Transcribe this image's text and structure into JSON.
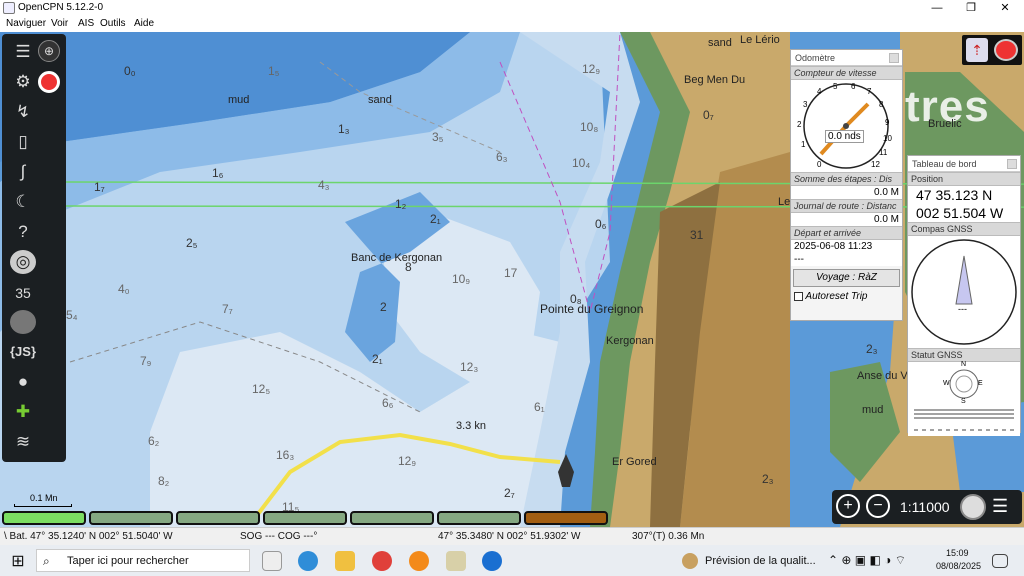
{
  "window": {
    "title": "OpenCPN 5.12.2-0",
    "minimize": "—",
    "maximize": "❐",
    "close": "✕"
  },
  "menu": [
    "Naviguer",
    "Voir",
    "AIS",
    "Outils",
    "Aide"
  ],
  "toolbar": {
    "items": [
      "menu-icon",
      "compass-icon",
      "settings-icon",
      "lifebuoy-icon",
      "route-icon",
      "chart-icon",
      "track-icon",
      "moon-icon",
      "help-icon",
      "layer-icon",
      "display-icon",
      "zoom-rect-icon",
      "js-plugin-icon",
      "globe-icon",
      "puzzle-icon",
      "tide-icon"
    ],
    "js_label": "{JS}",
    "scale_num": "35"
  },
  "chart": {
    "labels": {
      "mud1": "mud",
      "sand1": "sand",
      "sand_top": "sand",
      "le_lerio": "Le Lério",
      "beg_men_du": "Beg Men Du",
      "banc": "Banc de Kergonan",
      "pointe": "Pointe du Greignon",
      "kergonan": "Kergonan",
      "er_gored": "Er Gored",
      "anse": "Anse du V",
      "mud2": "mud",
      "tres": "tres",
      "bruelic": "Bruelic",
      "distance": "3.3 kn",
      "le": "Le"
    },
    "depths": [
      {
        "v": "0₀"
      },
      {
        "v": "1₅"
      },
      {
        "v": "1₃"
      },
      {
        "v": "1₆"
      },
      {
        "v": "1₇"
      },
      {
        "v": "1₂"
      },
      {
        "v": "2₁"
      },
      {
        "v": "2₅"
      },
      {
        "v": "8"
      },
      {
        "v": "2"
      },
      {
        "v": "2₁"
      },
      {
        "v": "4₀"
      },
      {
        "v": "5₄"
      },
      {
        "v": "7₇"
      },
      {
        "v": "7₉"
      },
      {
        "v": "12₅"
      },
      {
        "v": "16₃"
      },
      {
        "v": "6₂"
      },
      {
        "v": "8₂"
      },
      {
        "v": "11₅"
      },
      {
        "v": "6₆"
      },
      {
        "v": "12₃"
      },
      {
        "v": "6₁"
      },
      {
        "v": "10₉"
      },
      {
        "v": "17"
      },
      {
        "v": "3₅"
      },
      {
        "v": "4₃"
      },
      {
        "v": "6₃"
      },
      {
        "v": "10₄"
      },
      {
        "v": "10₈"
      },
      {
        "v": "12₉"
      },
      {
        "v": "0₈"
      },
      {
        "v": "0₆"
      },
      {
        "v": "0₇"
      },
      {
        "v": "2₇"
      },
      {
        "v": "31"
      },
      {
        "v": "2₃"
      },
      {
        "v": "2₃"
      },
      {
        "v": "12₉"
      }
    ]
  },
  "odometer": {
    "title": "Odomètre",
    "speed_section": "Compteur de vitesse",
    "speed_value": "0.0 nds",
    "ticks": [
      "0",
      "1",
      "2",
      "3",
      "4",
      "5",
      "6",
      "7",
      "8",
      "9",
      "10",
      "11",
      "12"
    ],
    "sum_label": "Somme des étapes : Dis",
    "sum_value": "0.0 M",
    "journal_label": "Journal de route : Distanc",
    "journal_value": "0.0 M",
    "depart_label": "Départ et arrivée",
    "depart_value": "2025-06-08 11:23",
    "arrive_value": "---",
    "reset_button": "Voyage : RàZ",
    "autoreset": "Autoreset Trip"
  },
  "dashboard": {
    "title": "Tableau de bord",
    "position_label": "Position",
    "lat": "47 35.123 N",
    "lon": "002 51.504 W",
    "compass_label": "Compas GNSS",
    "compass_value": "---",
    "gnss_label": "Statut GNSS",
    "gnss_n": "N",
    "gnss_e": "E",
    "gnss_s": "S",
    "gnss_w": "W"
  },
  "scale_bar": "0.1 Mn",
  "zoom": {
    "scale": "1:11000"
  },
  "status": {
    "boat": "\\ Bat. 47° 35.1240' N   002° 51.5040' W",
    "sog": "SOG --- COG ---°",
    "cursor": "47° 35.3480' N   002° 51.9302' W",
    "bearing": "307°(T)  0.36 Mn"
  },
  "taskbar": {
    "search": "Taper ici pour rechercher",
    "weather": "Prévision de la qualit...",
    "time": "15:09",
    "date": "08/08/2025"
  }
}
